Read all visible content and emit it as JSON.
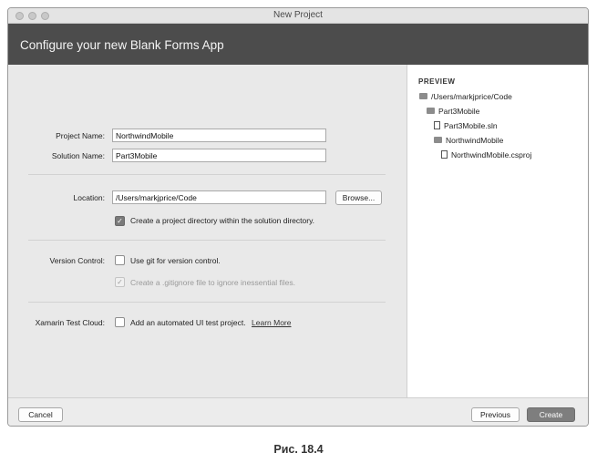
{
  "window": {
    "title": "New Project"
  },
  "header": {
    "title": "Configure your new Blank Forms App"
  },
  "form": {
    "project_name_label": "Project Name:",
    "project_name_value": "NorthwindMobile",
    "solution_name_label": "Solution Name:",
    "solution_name_value": "Part3Mobile",
    "location_label": "Location:",
    "location_value": "/Users/markjprice/Code",
    "browse_label": "Browse...",
    "create_dir": {
      "label": "Create a project directory within the solution directory.",
      "checked": true
    },
    "version_control_label": "Version Control:",
    "use_git": {
      "label": "Use git for version control.",
      "checked": false
    },
    "gitignore": {
      "label": "Create a .gitignore file to ignore inessential files.",
      "checked": true,
      "disabled": true
    },
    "test_cloud_label": "Xamarin Test Cloud:",
    "ui_test": {
      "label": "Add an automated UI test project.",
      "checked": false
    },
    "learn_more_label": "Learn More"
  },
  "preview": {
    "heading": "PREVIEW",
    "items": [
      {
        "label": "/Users/markjprice/Code",
        "icon": "folder-icon"
      },
      {
        "label": "Part3Mobile",
        "icon": "folder-icon"
      },
      {
        "label": "Part3Mobile.sln",
        "icon": "file-icon"
      },
      {
        "label": "NorthwindMobile",
        "icon": "folder-icon"
      },
      {
        "label": "NorthwindMobile.csproj",
        "icon": "file-icon"
      }
    ]
  },
  "footer": {
    "cancel_label": "Cancel",
    "previous_label": "Previous",
    "create_label": "Create"
  },
  "caption": "Рис. 18.4",
  "colors": {
    "header_bg": "#4c4c4c",
    "primary_button": "#7e7e7e"
  }
}
